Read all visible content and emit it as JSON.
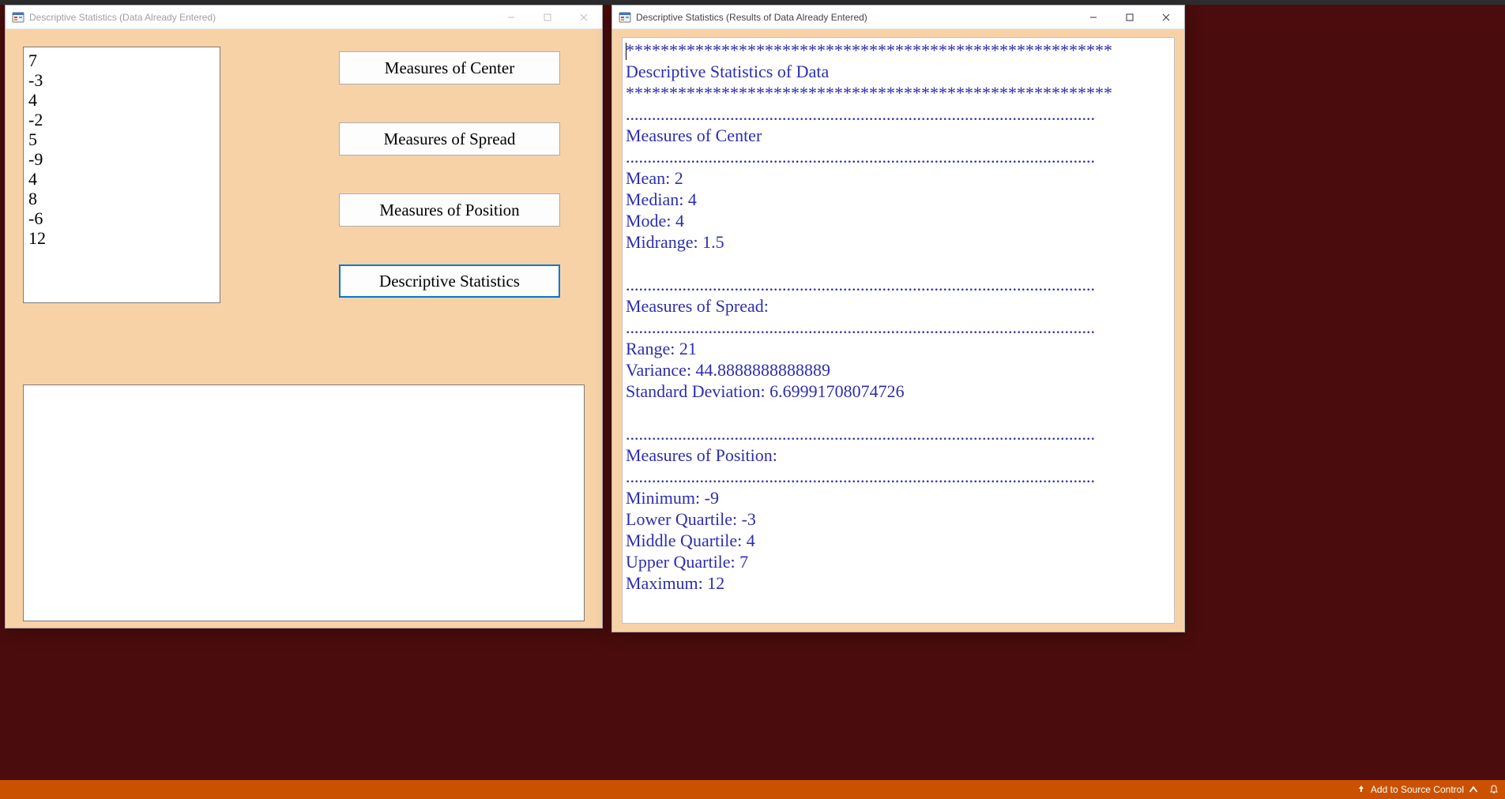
{
  "windows": {
    "input": {
      "title": "Descriptive Statistics (Data Already Entered)",
      "data_values": [
        "7",
        "-3",
        "4",
        "-2",
        "5",
        "-9",
        "4",
        "8",
        "-6",
        "12"
      ],
      "buttons": {
        "center": "Measures of Center",
        "spread": "Measures of Spread",
        "position": "Measures of Position",
        "desc": "Descriptive Statistics"
      }
    },
    "results": {
      "title": "Descriptive Statistics (Results of Data Already Entered)",
      "lines": [
        "********************************************************",
        "Descriptive Statistics of Data",
        "********************************************************",
        "............................................................................................................",
        "Measures of Center",
        "............................................................................................................",
        "Mean: 2",
        "Median: 4",
        "Mode: 4",
        "Midrange: 1.5",
        "",
        "............................................................................................................",
        "Measures of Spread:",
        "............................................................................................................",
        "Range: 21",
        "Variance: 44.8888888888889",
        "Standard Deviation: 6.69991708074726",
        "",
        "............................................................................................................",
        "Measures of Position:",
        "............................................................................................................",
        "Minimum: -9",
        "Lower Quartile: -3",
        "Middle Quartile: 4",
        "Upper Quartile: 7",
        "Maximum: 12"
      ]
    }
  },
  "statusbar": {
    "source_control": "Add to Source Control"
  }
}
